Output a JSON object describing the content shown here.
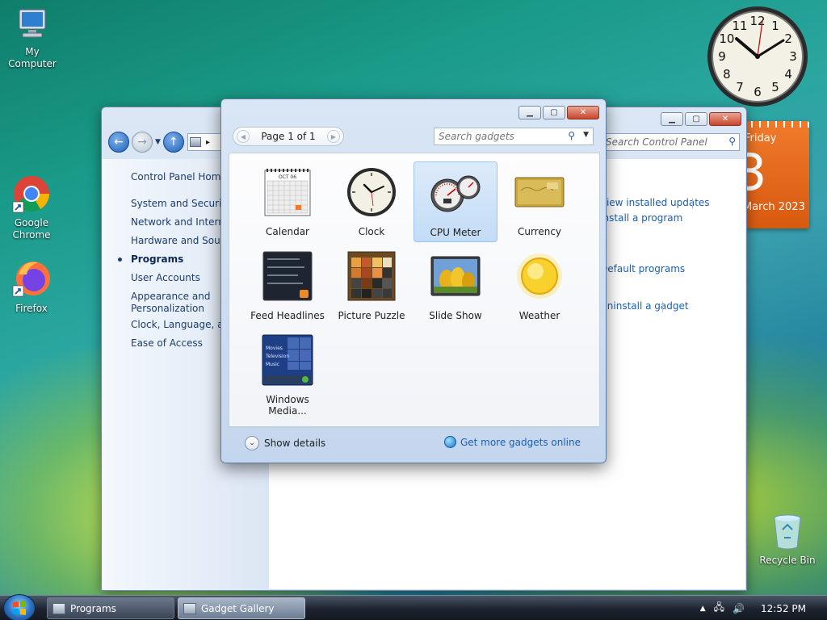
{
  "desktop": {
    "icons": [
      {
        "label": "My Computer"
      },
      {
        "label": "Google Chrome"
      },
      {
        "label": "Firefox"
      },
      {
        "label": "Recycle Bin"
      }
    ]
  },
  "clock_gadget": {
    "numbers": [
      "12",
      "1",
      "2",
      "3",
      "4",
      "5",
      "6",
      "7",
      "8",
      "9",
      "10",
      "11"
    ]
  },
  "calendar_gadget": {
    "day": "Friday",
    "date": "3",
    "month_year": "March 2023"
  },
  "explorer": {
    "title": "Programs",
    "search_placeholder": "Search Control Panel",
    "sidebar": {
      "items": [
        "Control Panel Home",
        "System and Security",
        "Network and Internet",
        "Hardware and Sound",
        "Programs",
        "User Accounts",
        "Appearance and Personalization",
        "Clock, Language, and Region",
        "Ease of Access"
      ],
      "current": "Programs"
    },
    "content_links": [
      "View installed updates",
      "Install a program",
      "Default programs",
      "Uninstall a gadget"
    ]
  },
  "gallery": {
    "title": "Gadget Gallery",
    "page_indicator": "Page 1 of 1",
    "search_placeholder": "Search gadgets",
    "selected": "CPU Meter",
    "gadgets": [
      {
        "name": "Calendar"
      },
      {
        "name": "Clock"
      },
      {
        "name": "CPU Meter"
      },
      {
        "name": "Currency"
      },
      {
        "name": "Feed Headlines"
      },
      {
        "name": "Picture Puzzle"
      },
      {
        "name": "Slide Show"
      },
      {
        "name": "Weather"
      },
      {
        "name": "Windows Media..."
      }
    ],
    "calendar_thumb_month": "OCT 06",
    "media_thumb_lines": [
      "Movies",
      "Television",
      "Music"
    ],
    "show_details": "Show details",
    "get_more": "Get more gadgets online"
  },
  "taskbar": {
    "buttons": [
      {
        "label": "Programs"
      },
      {
        "label": "Gadget Gallery"
      }
    ],
    "time": "12:52 PM"
  }
}
